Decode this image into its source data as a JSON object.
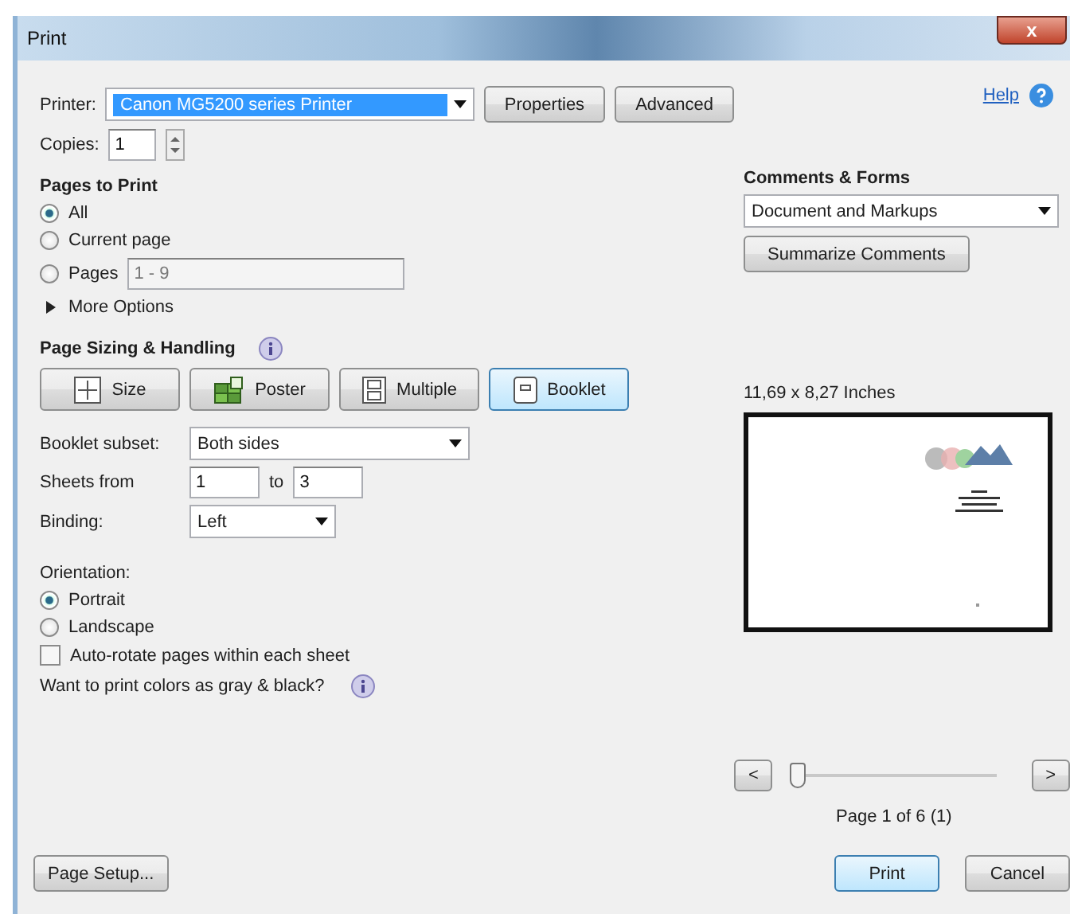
{
  "window": {
    "title": "Print",
    "close": "x"
  },
  "printer": {
    "label": "Printer:",
    "value": "Canon MG5200 series Printer",
    "buttons": [
      "Properties",
      "Advanced"
    ]
  },
  "help": {
    "label": "Help"
  },
  "copies": {
    "label": "Copies:",
    "value": "1"
  },
  "pages_to_print": {
    "heading": "Pages to Print",
    "options": [
      {
        "label": "All",
        "selected": true
      },
      {
        "label": "Current page",
        "selected": false
      },
      {
        "label": "Pages",
        "selected": false,
        "range": "1 - 9"
      }
    ],
    "more_options": "More Options"
  },
  "page_sizing": {
    "heading": "Page Sizing & Handling",
    "modes": [
      {
        "label": "Size",
        "kind": "size",
        "selected": false
      },
      {
        "label": "Poster",
        "kind": "poster",
        "selected": false
      },
      {
        "label": "Multiple",
        "kind": "multiple",
        "selected": false
      },
      {
        "label": "Booklet",
        "kind": "booklet",
        "selected": true
      }
    ],
    "booklet_subset": {
      "label": "Booklet subset:",
      "value": "Both sides"
    },
    "sheets": {
      "label": "Sheets from",
      "from": "1",
      "to_label": "to",
      "to": "3"
    },
    "binding": {
      "label": "Binding:",
      "value": "Left"
    }
  },
  "orientation": {
    "label": "Orientation:",
    "options": [
      {
        "label": "Portrait",
        "selected": true
      },
      {
        "label": "Landscape",
        "selected": false
      }
    ]
  },
  "auto_rotate": {
    "label": "Auto-rotate pages within each sheet",
    "checked": false
  },
  "gray_print": {
    "label": "Want to print colors as gray & black?"
  },
  "comments_forms": {
    "heading": "Comments & Forms",
    "value": "Document and Markups",
    "button": "Summarize Comments"
  },
  "preview": {
    "size": "11,69 x 8,27 Inches",
    "prev": "<",
    "next": ">",
    "level": 0,
    "page_label": "Page 1 of 6 (1)"
  },
  "footer": {
    "page_setup": "Page Setup...",
    "print": "Print",
    "cancel": "Cancel"
  }
}
